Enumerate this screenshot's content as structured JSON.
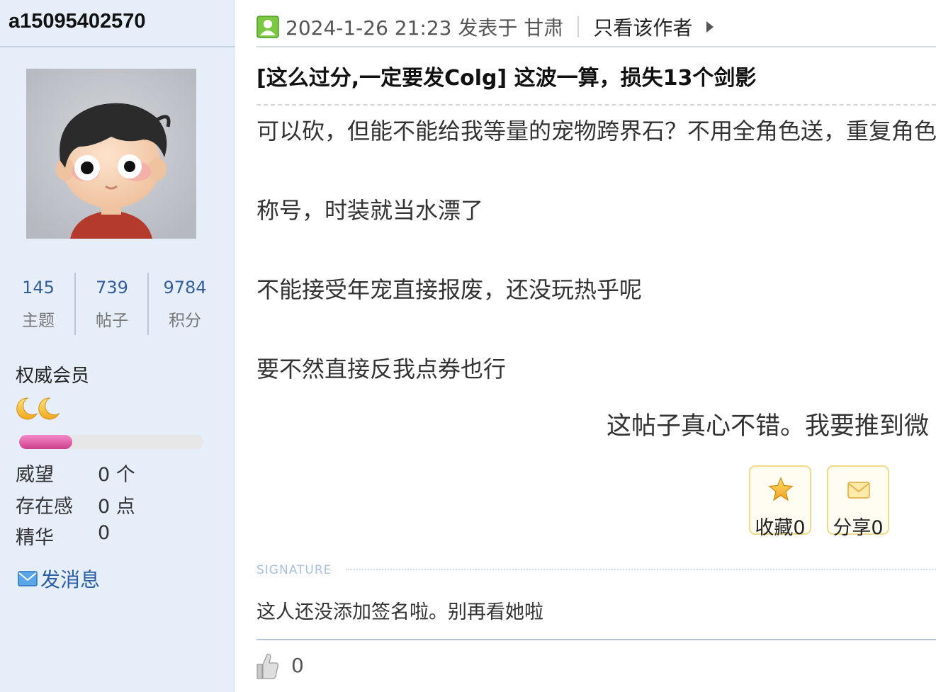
{
  "sidebar": {
    "username": "a15095402570",
    "avatar": "cartoon-boy-avatar",
    "stats": [
      {
        "value": "145",
        "label": "主题"
      },
      {
        "value": "739",
        "label": "帖子"
      },
      {
        "value": "9784",
        "label": "积分"
      }
    ],
    "group": "权威会员",
    "level_icons": "moon-icon",
    "rank_progress": 0.29,
    "info": [
      {
        "key": "威望",
        "value": "0 个"
      },
      {
        "key": "存在感",
        "value": "0 点"
      },
      {
        "key": "精华",
        "value": "0"
      }
    ],
    "send_message": "发消息"
  },
  "post": {
    "meta": "2024-1-26 21:23 发表于 甘肃",
    "author_only": "只看该作者",
    "title": "[这么过分,一定要发Colg] 这波一算，损失13个剑影",
    "paragraphs": [
      "可以砍，但能不能给我等量的宠物跨界石？不用全角色送，重复角色",
      "称号，时装就当水漂了",
      "不能接受年宠直接报废，还没玩热乎呢",
      "要不然直接反我点券也行"
    ],
    "promo": "这帖子真心不错。我要推到微",
    "actions": [
      {
        "label": "收藏0",
        "icon": "star-icon"
      },
      {
        "label": "分享0",
        "icon": "envelope-icon"
      }
    ],
    "signature_label": "SIGNATURE",
    "signature": "这人还没添加签名啦。别再看她啦",
    "likes": "0"
  },
  "colors": {
    "sidebar_bg": "#e6eefa",
    "link_blue": "#2a5ea5",
    "stat_blue": "#345d99",
    "rank_pink": "#e0559f",
    "button_border": "#f0d98a"
  }
}
